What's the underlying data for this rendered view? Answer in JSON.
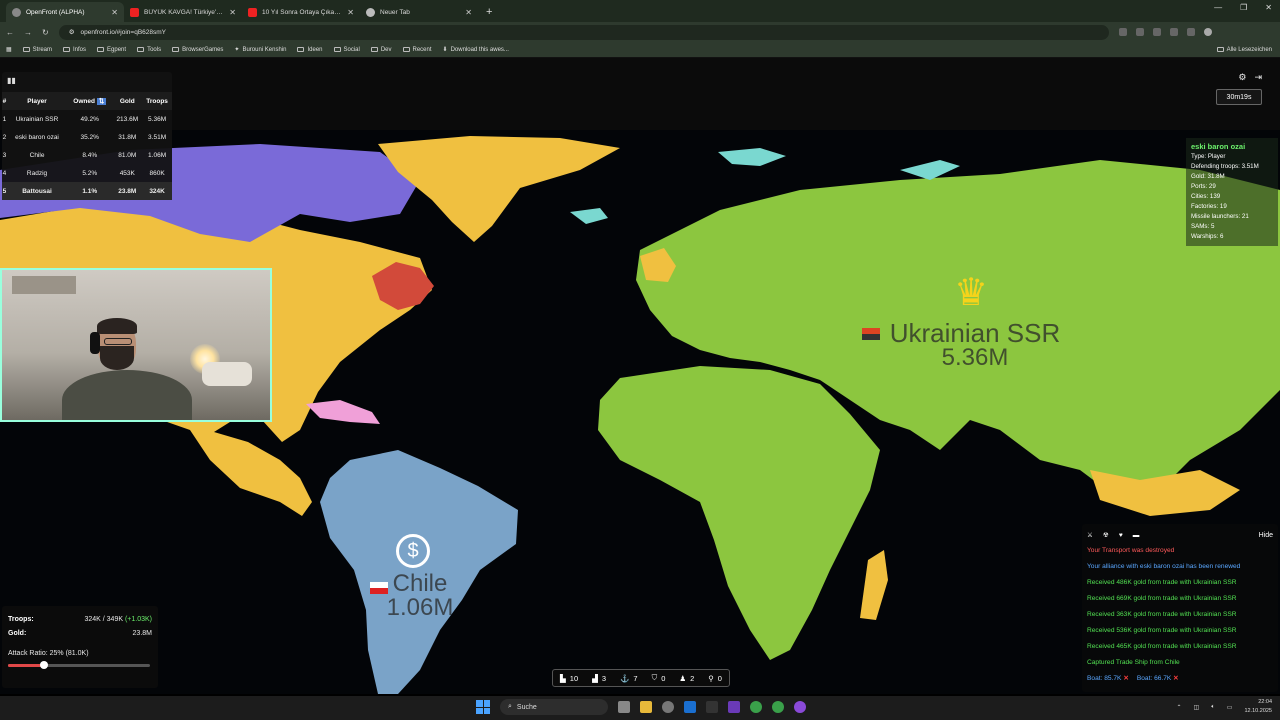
{
  "browser": {
    "tabs": [
      {
        "title": "OpenFront (ALPHA)",
        "active": true,
        "icon": "openfront-icon"
      },
      {
        "title": "BÜYÜK KAVGA! Türkiye'de Yaşı",
        "active": false,
        "icon": "youtube-icon"
      },
      {
        "title": "10 Yıl Sonra Ortaya Çıkan Gerçe",
        "active": false,
        "icon": "youtube-icon"
      },
      {
        "title": "Neuer Tab",
        "active": false,
        "icon": "newtab-icon"
      }
    ],
    "url": "openfront.io/#join=qB628smY",
    "bookmarks": [
      "Stream",
      "Infos",
      "Egpent",
      "Tools",
      "BrowserGames",
      "Burouni Kenshin",
      "Ideen",
      "Social",
      "Dev",
      "Recent",
      "Download this awes..."
    ],
    "all_bookmarks_label": "Alle Lesezeichen"
  },
  "leaderboard": {
    "headers": [
      "#",
      "Player",
      "Owned",
      "Gold",
      "Troops"
    ],
    "rows": [
      {
        "rank": "1",
        "player": "Ukrainian SSR",
        "owned": "49.2%",
        "gold": "213.6M",
        "troops": "5.36M"
      },
      {
        "rank": "2",
        "player": "eski baron ozai",
        "owned": "35.2%",
        "gold": "31.8M",
        "troops": "3.51M"
      },
      {
        "rank": "3",
        "player": "Chile",
        "owned": "8.4%",
        "gold": "81.0M",
        "troops": "1.06M"
      },
      {
        "rank": "4",
        "player": "Radzig",
        "owned": "5.2%",
        "gold": "453K",
        "troops": "860K"
      },
      {
        "rank": "5",
        "player": "Battousai",
        "owned": "1.1%",
        "gold": "23.8M",
        "troops": "324K"
      }
    ]
  },
  "timer": "30m19s",
  "player_info": {
    "name": "eski baron ozai",
    "type": "Type: Player",
    "defending": "Defending troops: 3.51M",
    "gold": "Gold: 31.8M",
    "ports": "Ports: 29",
    "cities": "Cities: 139",
    "factories": "Factories: 19",
    "missiles": "Missile launchers: 21",
    "sams": "SAMs: 5",
    "warships": "Warships: 6"
  },
  "map_labels": {
    "ukraine_name": "Ukrainian SSR",
    "ukraine_troops": "5.36M",
    "chile_name": "Chile",
    "chile_troops": "1.06M"
  },
  "stats": {
    "troops_label": "Troops:",
    "troops_value": "324K / 349K",
    "troops_delta": "(+1.03K)",
    "gold_label": "Gold:",
    "gold_value": "23.8M",
    "attack_label": "Attack Ratio: 25% (81.0K)",
    "attack_ratio": 0.25
  },
  "buildings": [
    {
      "icon": "city-icon",
      "count": "10"
    },
    {
      "icon": "factory-icon",
      "count": "3"
    },
    {
      "icon": "port-icon",
      "count": "7"
    },
    {
      "icon": "defense-icon",
      "count": "0"
    },
    {
      "icon": "missile-silo-icon",
      "count": "2"
    },
    {
      "icon": "sam-icon",
      "count": "0"
    }
  ],
  "event_log": {
    "hide_label": "Hide",
    "events": [
      {
        "text": "Your Transport was destroyed",
        "color": "red"
      },
      {
        "text": "Your alliance with eski baron ozai has been renewed",
        "color": "blue"
      },
      {
        "text": "Received 486K gold from trade with Ukrainian SSR",
        "color": "green"
      },
      {
        "text": "Received 669K gold from trade with Ukrainian SSR",
        "color": "green"
      },
      {
        "text": "Received 363K gold from trade with Ukrainian SSR",
        "color": "green"
      },
      {
        "text": "Received 536K gold from trade with Ukrainian SSR",
        "color": "green"
      },
      {
        "text": "Received 465K gold from trade with Ukrainian SSR",
        "color": "green"
      },
      {
        "text": "Captured Trade Ship from Chile",
        "color": "green"
      }
    ],
    "boats": [
      "Boat: 85.7K",
      "Boat: 66.7K"
    ]
  },
  "taskbar": {
    "search_label": "Suche",
    "time": "22:04",
    "date": "12.10.2025"
  },
  "colors": {
    "ukraine": "#8cc63f",
    "baron": "#f0c040",
    "chile": "#7aa3c8",
    "purple": "#7a6ad8",
    "red": "#d24a3a"
  }
}
